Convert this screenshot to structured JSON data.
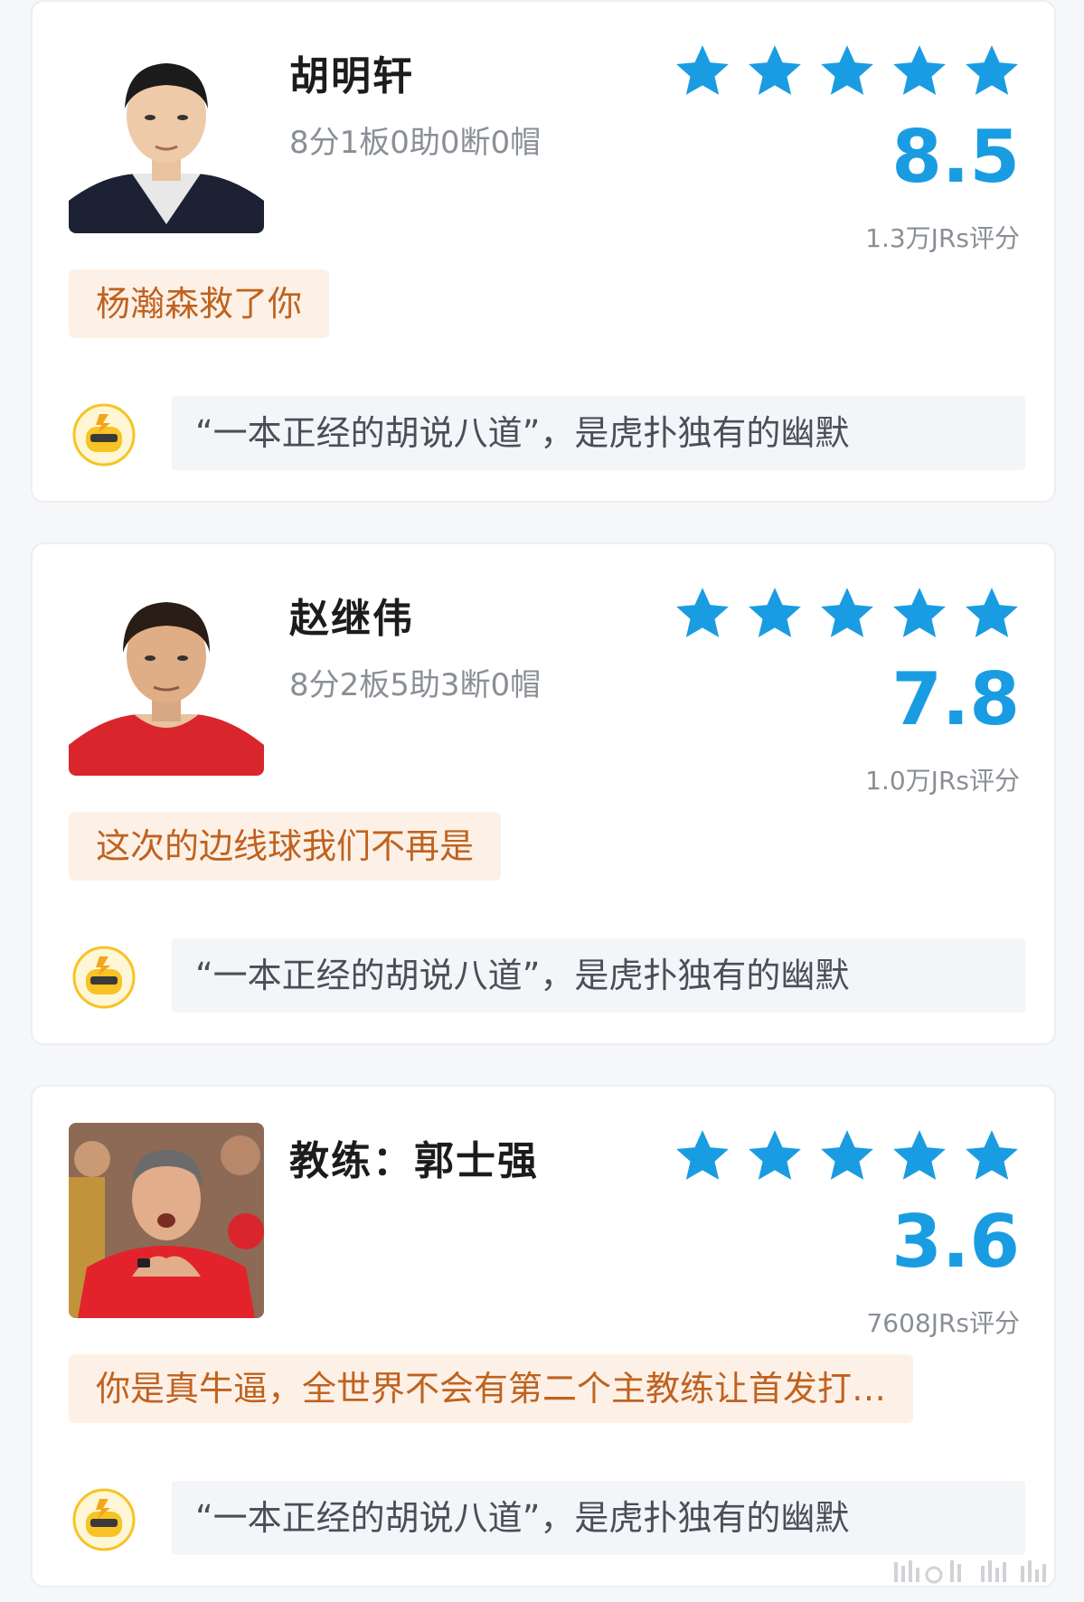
{
  "cards": [
    {
      "name": "胡明轩",
      "stats": "8分1板0助0断0帽",
      "score": "8.5",
      "raters": "1.3万JRs评分",
      "comment": "杨瀚森救了你",
      "slogan": "“一本正经的胡说八道”，是虎扑独有的幽默",
      "stars": 5,
      "photo_icon": "player-portrait-icon"
    },
    {
      "name": "赵继伟",
      "stats": "8分2板5助3断0帽",
      "score": "7.8",
      "raters": "1.0万JRs评分",
      "comment": "这次的边线球我们不再是",
      "slogan": "“一本正经的胡说八道”，是虎扑独有的幽默",
      "stars": 5,
      "photo_icon": "player-portrait-icon"
    },
    {
      "name": "教练：郭士强",
      "stats": "",
      "score": "3.6",
      "raters": "7608JRs评分",
      "comment": "你是真牛逼，全世界不会有第二个主教练让首发打…",
      "slogan": "“一本正经的胡说八道”，是虎扑独有的幽默",
      "stars": 5,
      "photo_icon": "coach-portrait-icon"
    }
  ],
  "colors": {
    "star": "#1a9ce2",
    "score": "#1a9ce2",
    "comment_bg": "#fdf1e7",
    "comment_text": "#c0621f",
    "slogan_bg": "#f3f5f8",
    "bot_avatar": "#f7c325"
  }
}
